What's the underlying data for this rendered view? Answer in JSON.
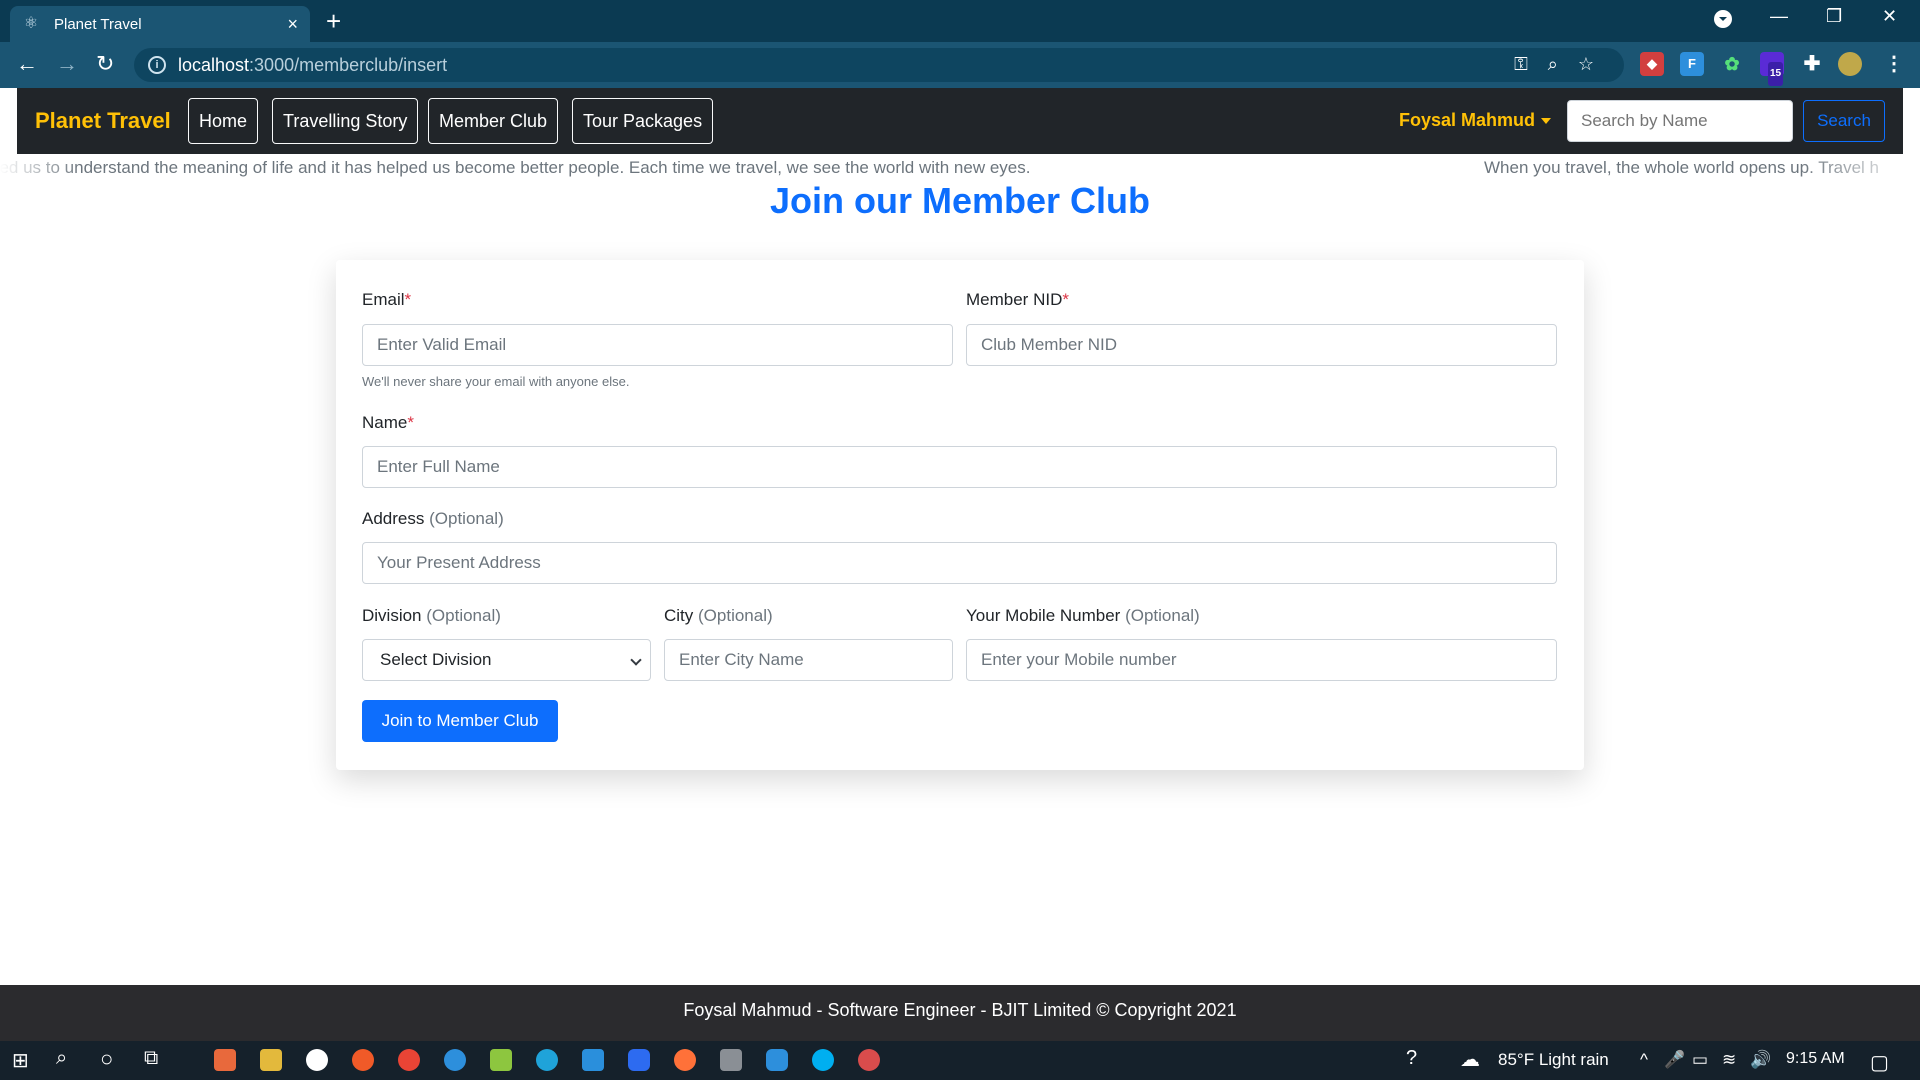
{
  "browser": {
    "tab_title": "Planet Travel",
    "tab_close": "×",
    "new_tab": "+",
    "url_host": "localhost",
    "url_path": ":3000/memberclub/insert",
    "ext_badge": "15"
  },
  "navbar": {
    "brand": "Planet Travel",
    "links": [
      "Home",
      "Travelling Story",
      "Member Club",
      "Tour Packages"
    ],
    "user": "Foysal Mahmud",
    "search_placeholder": "Search by Name",
    "search_button": "Search"
  },
  "marquee": {
    "left": "ped us to understand the meaning of life and it has helped us become better people. Each time we travel, we see the world with new eyes.",
    "right": "When you travel, the whole world opens up. Travel h"
  },
  "page": {
    "title": "Join our Member Club"
  },
  "form": {
    "email_label": "Email",
    "email_placeholder": "Enter Valid Email",
    "email_help": "We'll never share your email with anyone else.",
    "nid_label": "Member NID",
    "nid_placeholder": "Club Member NID",
    "name_label": "Name",
    "name_placeholder": "Enter Full Name",
    "address_label": "Address",
    "address_placeholder": "Your Present Address",
    "division_label": "Division",
    "division_selected": "Select Division",
    "city_label": "City",
    "city_placeholder": "Enter City Name",
    "mobile_label": "Your Mobile Number",
    "mobile_placeholder": "Enter your Mobile number",
    "required_mark": "*",
    "optional_mark": "(Optional)",
    "submit_label": "Join to Member Club"
  },
  "footer": {
    "text": "Foysal Mahmud - Software Engineer - BJIT Limited © Copyright 2021"
  },
  "taskbar": {
    "weather": "85°F  Light rain",
    "time": "9:15 AM"
  },
  "colors": {
    "primary": "#0d6efd",
    "brand": "#ffc107",
    "navbar_bg": "#212529",
    "required": "#dc3545",
    "footer_bg": "#2b2b2e",
    "chrome_bg": "#0b3a52"
  }
}
